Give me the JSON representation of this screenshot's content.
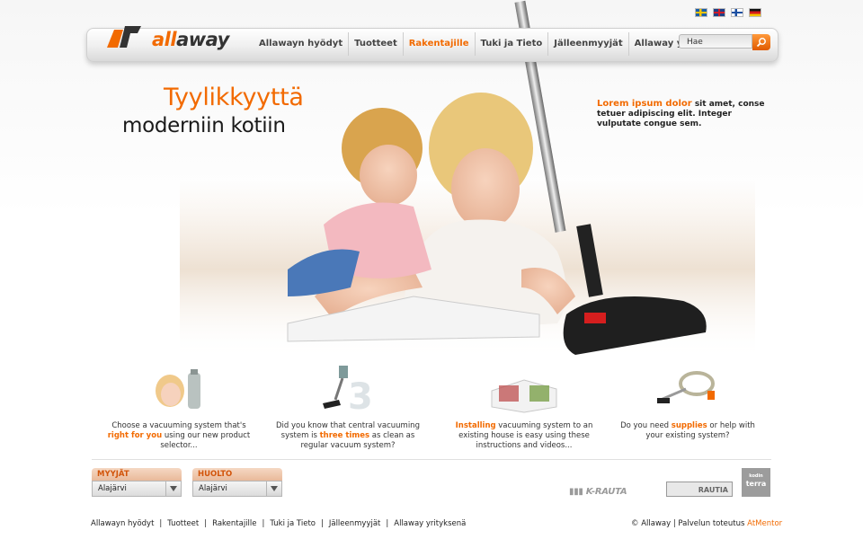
{
  "flags": [
    {
      "name": "swedish-flag-icon",
      "lang": "sv"
    },
    {
      "name": "english-flag-icon",
      "lang": "en"
    },
    {
      "name": "finnish-flag-icon",
      "lang": "fi"
    },
    {
      "name": "german-flag-icon",
      "lang": "de"
    }
  ],
  "logo": {
    "text_part1": "all",
    "text_part2": "away"
  },
  "nav": {
    "items": [
      {
        "label": "Allawayn hyödyt"
      },
      {
        "label": "Tuotteet"
      },
      {
        "label": "Rakentajille",
        "active": true
      },
      {
        "label": "Tuki ja Tieto"
      },
      {
        "label": "Jälleenmyyjät"
      },
      {
        "label": "Allaway yrityksenä"
      }
    ]
  },
  "search": {
    "placeholder": "Hae"
  },
  "hero": {
    "title_line1": "Tyylikkyyttä",
    "title_line2": "moderniin kotiin",
    "blurb_highlight": "Lorem ipsum dolor",
    "blurb_rest": " sit amet, conse tetuer adipiscing elit. Integer vulputate congue sem."
  },
  "features": [
    {
      "text_before": "Choose a vacuuming system that's ",
      "highlight": "right for you",
      "text_after": " using our new product selector..."
    },
    {
      "text_before": "Did you know that central vacuuming system is ",
      "highlight": "three times",
      "text_after": " as clean as regular vacuum system?"
    },
    {
      "text_before": "",
      "highlight": "Installing",
      "text_after": " vacuuming system to an existing house is easy using these instructions and videos..."
    },
    {
      "text_before": "Do you need ",
      "highlight": "supplies",
      "text_after": " or help with your existing system?"
    }
  ],
  "selectors": [
    {
      "label": "MYYJÄT",
      "value": "Alajärvi"
    },
    {
      "label": "HUOLTO",
      "value": "Alajärvi"
    }
  ],
  "partners": {
    "krauta": "K-RAUTA",
    "rautia": "RAUTIA",
    "terra_small": "kodin",
    "terra": "terra"
  },
  "footer": {
    "links": [
      {
        "label": "Allawayn hyödyt"
      },
      {
        "label": "Tuotteet"
      },
      {
        "label": "Rakentajille"
      },
      {
        "label": "Tuki ja Tieto"
      },
      {
        "label": "Jälleenmyyjät"
      },
      {
        "label": "Allaway yrityksenä"
      }
    ],
    "separator": "|",
    "copyright": "© Allaway | Palvelun toteutus ",
    "credit": "AtMentor"
  },
  "colors": {
    "accent": "#f26a00",
    "text": "#222222",
    "nav_bg": "#eeeeee"
  }
}
